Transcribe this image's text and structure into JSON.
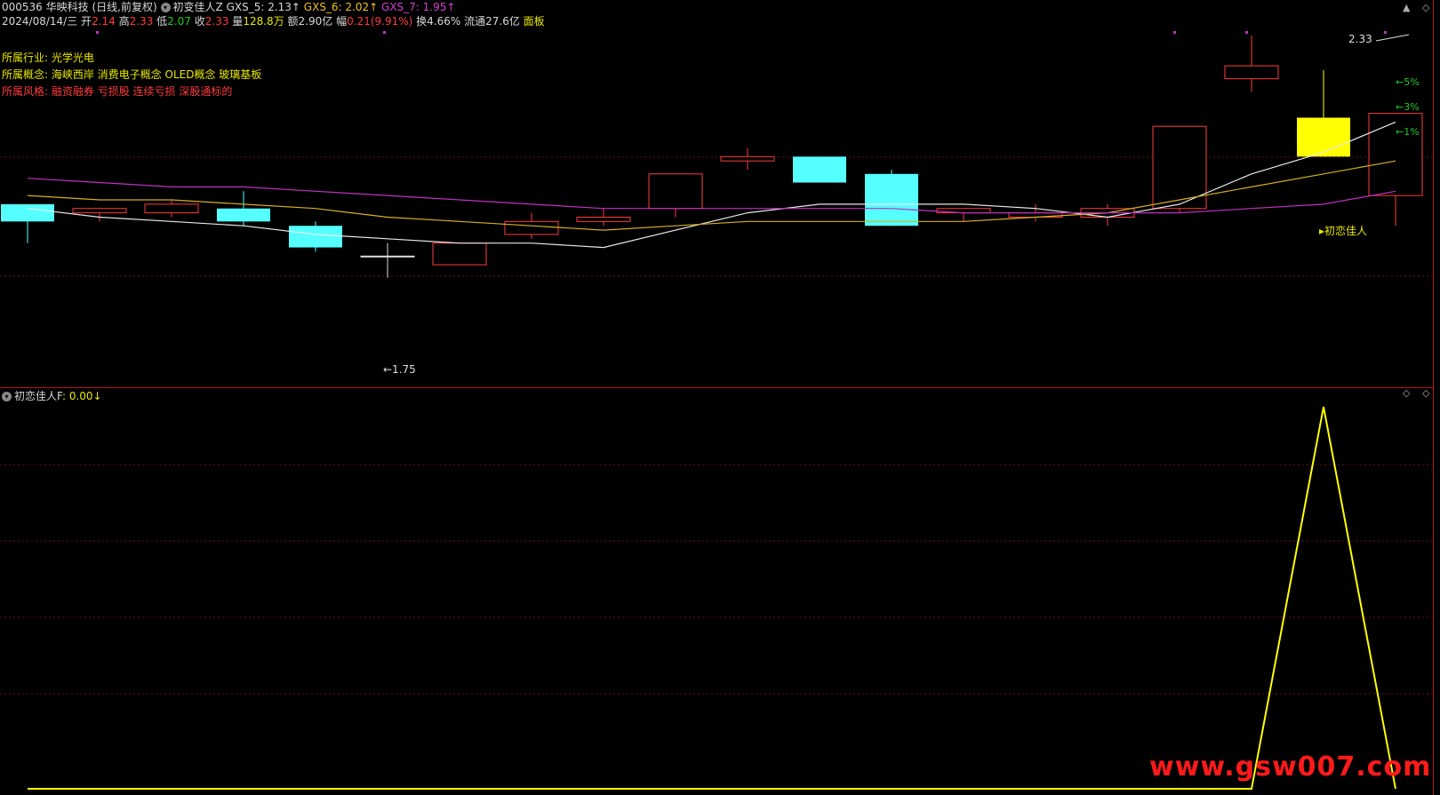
{
  "header": {
    "code": "000536",
    "name": "华映科技",
    "period": "(日线,前复权)",
    "indicator_name": "初变佳人Z",
    "gxs5": "GXS_5: 2.13↑",
    "gxs6": "GXS_6: 2.02↑",
    "gxs7": "GXS_7: 1.95↑",
    "date": "2024/08/14/三",
    "open_label": "开",
    "open": "2.14",
    "high_label": "高",
    "high": "2.33",
    "low_label": "低",
    "low": "2.07",
    "close_label": "收",
    "close": "2.33",
    "vol_label": "量",
    "vol": "128.8万",
    "amount_label": "额",
    "amount": "2.90亿",
    "change_label": "幅",
    "change": "0.21(9.91%)",
    "turnover_label": "换",
    "turnover": "4.66%",
    "float_label": "流通",
    "float": "27.6亿",
    "board": "面板"
  },
  "info": {
    "industry_label": "所属行业:",
    "industry": "光学光电",
    "concept_label": "所属概念:",
    "concept": "海峡西岸 消费电子概念 OLED概念 玻璃基板",
    "style_label": "所属风格:",
    "style": "融资融券 亏损股 连续亏损 深股通标的"
  },
  "annotations": {
    "high_value": "2.33",
    "low_value": "←1.75",
    "pct5": "←5%",
    "pct3": "←3%",
    "pct1": "←1%",
    "signal_label": "▸初恋佳人"
  },
  "subchart": {
    "title": "初恋佳人F",
    "value": ": 0.00↓"
  },
  "watermark": "www.gsw007.com",
  "colors": {
    "up": "#ff3b3b",
    "down": "#55ffff",
    "signal": "#ffff00",
    "ma5": "#e8e8e8",
    "ma6": "#d4b020",
    "ma7": "#c030c0"
  },
  "candles": [
    {
      "o": 2.12,
      "c": 2.08,
      "h": 2.12,
      "l": 2.03
    },
    {
      "o": 2.1,
      "c": 2.11,
      "h": 2.11,
      "l": 2.08
    },
    {
      "o": 2.1,
      "c": 2.12,
      "h": 2.13,
      "l": 2.09
    },
    {
      "o": 2.11,
      "c": 2.08,
      "h": 2.15,
      "l": 2.07
    },
    {
      "o": 2.07,
      "c": 2.02,
      "h": 2.08,
      "l": 2.01
    },
    {
      "o": 2.0,
      "c": 2.0,
      "h": 2.03,
      "l": 1.95
    },
    {
      "o": 1.98,
      "c": 2.03,
      "h": 2.03,
      "l": 1.98
    },
    {
      "o": 2.05,
      "c": 2.08,
      "h": 2.1,
      "l": 2.04
    },
    {
      "o": 2.08,
      "c": 2.09,
      "h": 2.11,
      "l": 2.07
    },
    {
      "o": 2.11,
      "c": 2.19,
      "h": 2.19,
      "l": 2.09
    },
    {
      "o": 2.22,
      "c": 2.23,
      "h": 2.25,
      "l": 2.2
    },
    {
      "o": 2.23,
      "c": 2.17,
      "h": 2.23,
      "l": 2.17
    },
    {
      "o": 2.19,
      "c": 2.07,
      "h": 2.2,
      "l": 2.07
    },
    {
      "o": 2.1,
      "c": 2.11,
      "h": 2.11,
      "l": 2.08
    },
    {
      "o": 2.09,
      "c": 2.1,
      "h": 2.12,
      "l": 2.08
    },
    {
      "o": 2.09,
      "c": 2.11,
      "h": 2.12,
      "l": 2.07
    },
    {
      "o": 2.11,
      "c": 2.3,
      "h": 2.3,
      "l": 2.1
    },
    {
      "o": 2.41,
      "c": 2.44,
      "h": 2.51,
      "l": 2.38
    },
    {
      "o": 2.32,
      "c": 2.23,
      "h": 2.43,
      "l": 2.23
    },
    {
      "o": 2.14,
      "c": 2.33,
      "h": 2.33,
      "l": 2.07
    }
  ],
  "signal_candle_index": 18,
  "ma": {
    "ma5": [
      2.11,
      2.09,
      2.08,
      2.07,
      2.05,
      2.04,
      2.03,
      2.03,
      2.02,
      2.06,
      2.1,
      2.12,
      2.12,
      2.12,
      2.11,
      2.09,
      2.12,
      2.19,
      2.24,
      2.31
    ],
    "ma6": [
      2.14,
      2.13,
      2.13,
      2.12,
      2.11,
      2.09,
      2.08,
      2.07,
      2.06,
      2.07,
      2.08,
      2.08,
      2.08,
      2.08,
      2.09,
      2.1,
      2.13,
      2.16,
      2.19,
      2.22
    ],
    "ma7": [
      2.18,
      2.17,
      2.16,
      2.16,
      2.15,
      2.14,
      2.13,
      2.12,
      2.11,
      2.11,
      2.11,
      2.11,
      2.11,
      2.1,
      2.1,
      2.1,
      2.1,
      2.11,
      2.12,
      2.15
    ]
  },
  "signal_series": [
    0,
    0,
    0,
    0,
    0,
    0,
    0,
    0,
    0,
    0,
    0,
    0,
    0,
    0,
    0,
    0,
    0,
    0,
    1,
    0
  ]
}
